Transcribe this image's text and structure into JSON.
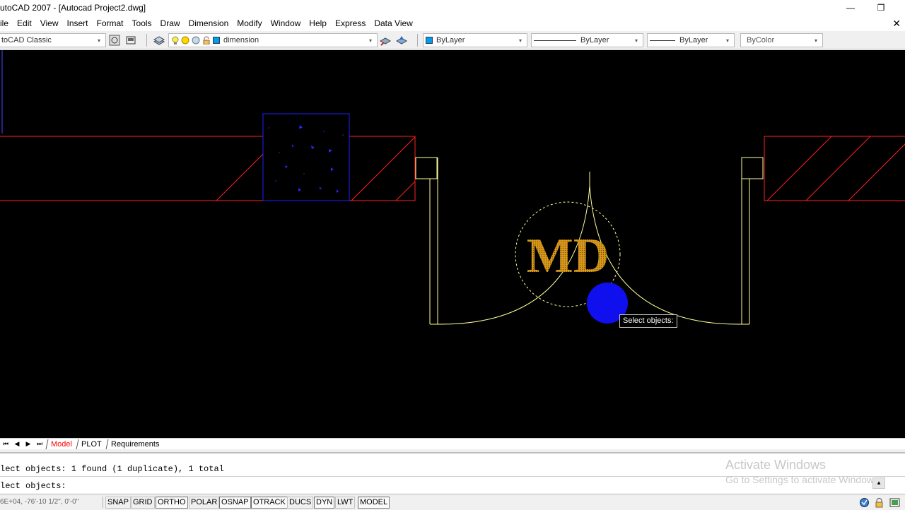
{
  "window": {
    "title": "utoCAD 2007 - [Autocad Project2.dwg]",
    "minimize_glyph": "—",
    "restore_glyph": "❐",
    "close_glyph": "✕"
  },
  "menu": [
    "ile",
    "Edit",
    "View",
    "Insert",
    "Format",
    "Tools",
    "Draw",
    "Dimension",
    "Modify",
    "Window",
    "Help",
    "Express",
    "Data View"
  ],
  "toolbar": {
    "workspace": "toCAD Classic",
    "layer": "dimension",
    "layer_color": "#00a0e0",
    "color": "ByLayer",
    "linetype": "ByLayer",
    "lineweight": "ByLayer",
    "plotstyle": "ByColor",
    "dropdown_glyph": "▾"
  },
  "canvas": {
    "background": "#000000",
    "wall_color": "#ff2020",
    "door_color": "#ffff99",
    "selection_color": "#2020ff",
    "watermark_logo": "MD",
    "tooltip": "Select objects:"
  },
  "layout_tabs": {
    "nav": [
      "⏮",
      "◀",
      "▶",
      "⏭"
    ],
    "tabs": [
      "Model",
      "PLOT",
      "Requirements"
    ],
    "active": "Model"
  },
  "command": {
    "history": "lect objects: 1 found (1 duplicate), 1 total",
    "prompt": "lect objects:",
    "scroll_glyph": "▲"
  },
  "activation": {
    "line1": "Activate Windows",
    "line2": "Go to Settings to activate Windows."
  },
  "status": {
    "coords": "6E+04,  -76'-10 1/2\", 0'-0\"",
    "toggles": [
      "SNAP",
      "GRID",
      "ORTHO",
      "POLAR",
      "OSNAP",
      "OTRACK",
      "DUCS",
      "DYN",
      "LWT",
      "MODEL"
    ]
  }
}
